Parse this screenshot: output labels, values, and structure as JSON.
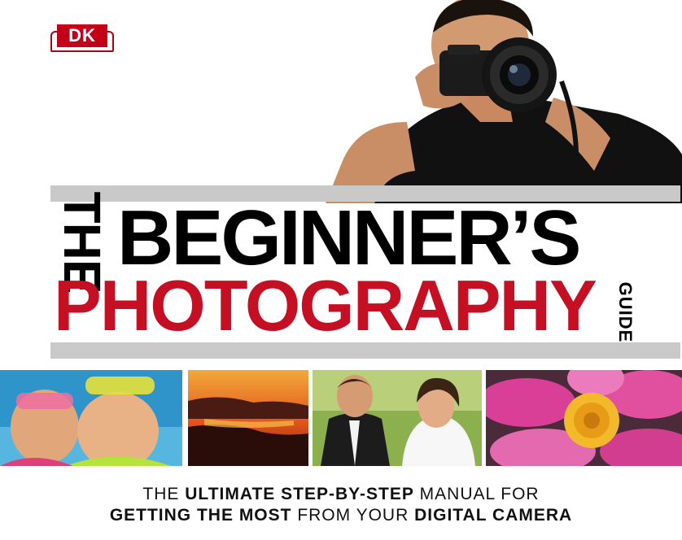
{
  "publisher_logo": "DK",
  "title": {
    "prefix": "THE",
    "line1": "BEGINNER’S",
    "line2": "PHOTOGRAPHY",
    "suffix": "GUIDE"
  },
  "colors": {
    "title_black": "#000000",
    "title_red": "#c50f23",
    "bars": "#c9c9c9",
    "logo_red": "#c40018"
  },
  "photos": [
    "snorkel-kids",
    "sunset-lake",
    "wedding-couple",
    "pink-flower"
  ],
  "tagline": {
    "line1": [
      {
        "text": "THE ",
        "bold": false
      },
      {
        "text": "ULTIMATE STEP-BY-STEP",
        "bold": true
      },
      {
        "text": " MANUAL FOR",
        "bold": false
      }
    ],
    "line2": [
      {
        "text": "GETTING THE MOST",
        "bold": true
      },
      {
        "text": " FROM YOUR ",
        "bold": false
      },
      {
        "text": "DIGITAL CAMERA",
        "bold": true
      }
    ]
  }
}
